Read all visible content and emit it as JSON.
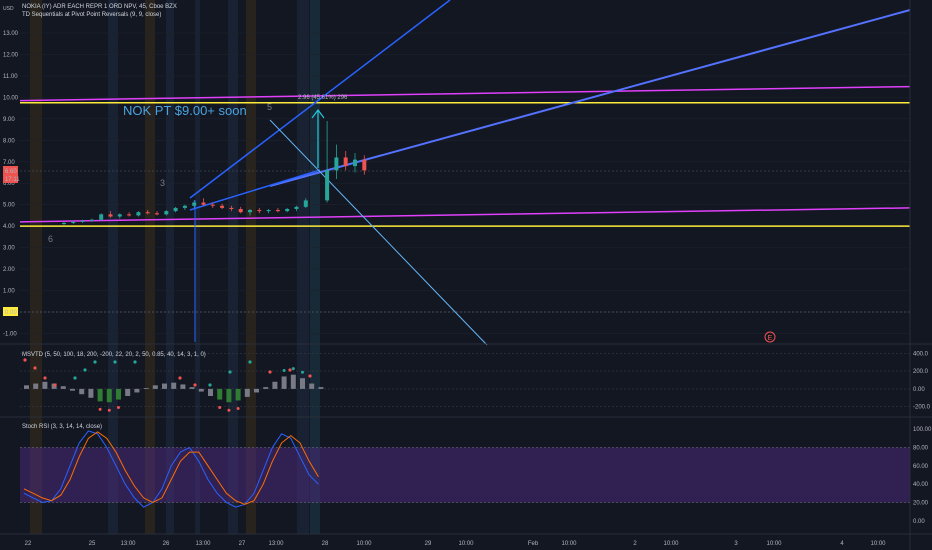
{
  "header": {
    "currency": "USD",
    "title": "NOKIA (IY) ADR EACH REPR 1 ORD NPV, 45, Cboe BZX",
    "indicator": "TD Sequentials at Pivot Point Reversals (9, 9, close)"
  },
  "annotation": {
    "text": "NOK PT $9.00+ soon",
    "measure": "2.96 (45.61%) 296"
  },
  "price_axis": {
    "ticks": [
      "13.00",
      "12.00",
      "11.00",
      "10.00",
      "9.00",
      "8.00",
      "7.00",
      "6.00",
      "5.00",
      "4.00",
      "3.00",
      "2.00",
      "1.00",
      "0.00",
      "-1.00"
    ],
    "current_price": "6.60",
    "countdown": "17:11",
    "zero_label": "0.00"
  },
  "time_axis": {
    "labels": [
      "22",
      "25",
      "13:00",
      "26",
      "13:00",
      "27",
      "13:00",
      "28",
      "10:00",
      "29",
      "10:00",
      "Feb",
      "10:00",
      "2",
      "10:00",
      "3",
      "10:00",
      "4",
      "10:00"
    ]
  },
  "td_counts": [
    "6",
    "3",
    "5"
  ],
  "earnings_marker": "E",
  "msvtd": {
    "label": "MSVTD (5, 50, 100, 18, 200, -200, 22, 20, 2, 50, 0.85, 40, 14, 3, 1, 0)",
    "ticks": [
      "400.0",
      "200.0",
      "0.00",
      "-200.0"
    ]
  },
  "stoch_rsi": {
    "label": "Stoch RSI (3, 3, 14, 14, close)",
    "ticks": [
      "100.00",
      "80.00",
      "60.00",
      "40.00",
      "20.00",
      "0.00"
    ]
  },
  "colors": {
    "background": "#131722",
    "up": "#26a69a",
    "down": "#ef5350",
    "magenta": "#e040fb",
    "yellow": "#ffeb3b",
    "trend_blue": "#2962ff",
    "light_blue": "#64b5f6",
    "stoch_band": "#4a2a7a"
  },
  "chart_data": {
    "type": "candlestick",
    "title": "NOKIA (IY) ADR EACH REPR 1 ORD NPV, 45, Cboe BZX",
    "ylim": [
      -1.5,
      14
    ],
    "candles": [
      {
        "o": 4.1,
        "h": 4.2,
        "l": 4.05,
        "c": 4.15
      },
      {
        "o": 4.15,
        "h": 4.25,
        "l": 4.1,
        "c": 4.2
      },
      {
        "o": 4.2,
        "h": 4.3,
        "l": 4.15,
        "c": 4.25
      },
      {
        "o": 4.25,
        "h": 4.35,
        "l": 4.2,
        "c": 4.3
      },
      {
        "o": 4.3,
        "h": 4.6,
        "l": 4.25,
        "c": 4.55
      },
      {
        "o": 4.55,
        "h": 4.7,
        "l": 4.4,
        "c": 4.45
      },
      {
        "o": 4.45,
        "h": 4.6,
        "l": 4.35,
        "c": 4.55
      },
      {
        "o": 4.55,
        "h": 4.65,
        "l": 4.45,
        "c": 4.5
      },
      {
        "o": 4.5,
        "h": 4.7,
        "l": 4.45,
        "c": 4.65
      },
      {
        "o": 4.65,
        "h": 4.75,
        "l": 4.55,
        "c": 4.6
      },
      {
        "o": 4.6,
        "h": 4.7,
        "l": 4.5,
        "c": 4.55
      },
      {
        "o": 4.55,
        "h": 4.75,
        "l": 4.5,
        "c": 4.7
      },
      {
        "o": 4.7,
        "h": 4.9,
        "l": 4.65,
        "c": 4.85
      },
      {
        "o": 4.85,
        "h": 5.0,
        "l": 4.75,
        "c": 4.95
      },
      {
        "o": 4.95,
        "h": 5.2,
        "l": 4.85,
        "c": 5.1
      },
      {
        "o": 5.1,
        "h": 5.3,
        "l": 4.95,
        "c": 5.0
      },
      {
        "o": 5.0,
        "h": 5.1,
        "l": 4.85,
        "c": 4.95
      },
      {
        "o": 4.95,
        "h": 5.05,
        "l": 4.8,
        "c": 4.85
      },
      {
        "o": 4.85,
        "h": 4.95,
        "l": 4.7,
        "c": 4.8
      },
      {
        "o": 4.8,
        "h": 4.9,
        "l": 4.6,
        "c": 4.65
      },
      {
        "o": 4.65,
        "h": 4.8,
        "l": 4.5,
        "c": 4.75
      },
      {
        "o": 4.75,
        "h": 4.85,
        "l": 4.6,
        "c": 4.7
      },
      {
        "o": 4.7,
        "h": 4.8,
        "l": 4.6,
        "c": 4.75
      },
      {
        "o": 4.75,
        "h": 4.85,
        "l": 4.65,
        "c": 4.7
      },
      {
        "o": 4.7,
        "h": 4.85,
        "l": 4.65,
        "c": 4.8
      },
      {
        "o": 4.8,
        "h": 4.95,
        "l": 4.7,
        "c": 4.9
      },
      {
        "o": 4.9,
        "h": 5.3,
        "l": 4.85,
        "c": 5.2
      },
      {
        "o": 5.2,
        "h": 8.9,
        "l": 5.1,
        "c": 6.6
      },
      {
        "o": 6.6,
        "h": 7.8,
        "l": 6.2,
        "c": 7.2
      },
      {
        "o": 7.2,
        "h": 7.5,
        "l": 6.6,
        "c": 6.8
      },
      {
        "o": 6.8,
        "h": 7.4,
        "l": 6.5,
        "c": 7.1
      },
      {
        "o": 7.1,
        "h": 7.3,
        "l": 6.4,
        "c": 6.6
      }
    ],
    "horizontal_levels": [
      {
        "price": 9.85,
        "color": "magenta"
      },
      {
        "price": 9.75,
        "color": "yellow"
      },
      {
        "price": 4.2,
        "color": "magenta"
      },
      {
        "price": 4.0,
        "color": "yellow"
      }
    ],
    "msvtd": {
      "ylim": [
        -260,
        460
      ]
    },
    "stoch_rsi": {
      "ylim": [
        -10,
        110
      ],
      "k": [
        30,
        25,
        20,
        22,
        35,
        60,
        85,
        98,
        95,
        80,
        60,
        40,
        25,
        15,
        20,
        35,
        60,
        75,
        80,
        65,
        45,
        30,
        20,
        15,
        18,
        30,
        55,
        80,
        95,
        90,
        70,
        50,
        40
      ],
      "d": [
        35,
        30,
        25,
        22,
        28,
        45,
        70,
        90,
        97,
        90,
        75,
        55,
        38,
        25,
        20,
        25,
        45,
        65,
        75,
        75,
        60,
        45,
        30,
        22,
        18,
        22,
        40,
        65,
        85,
        93,
        85,
        65,
        48
      ]
    }
  }
}
